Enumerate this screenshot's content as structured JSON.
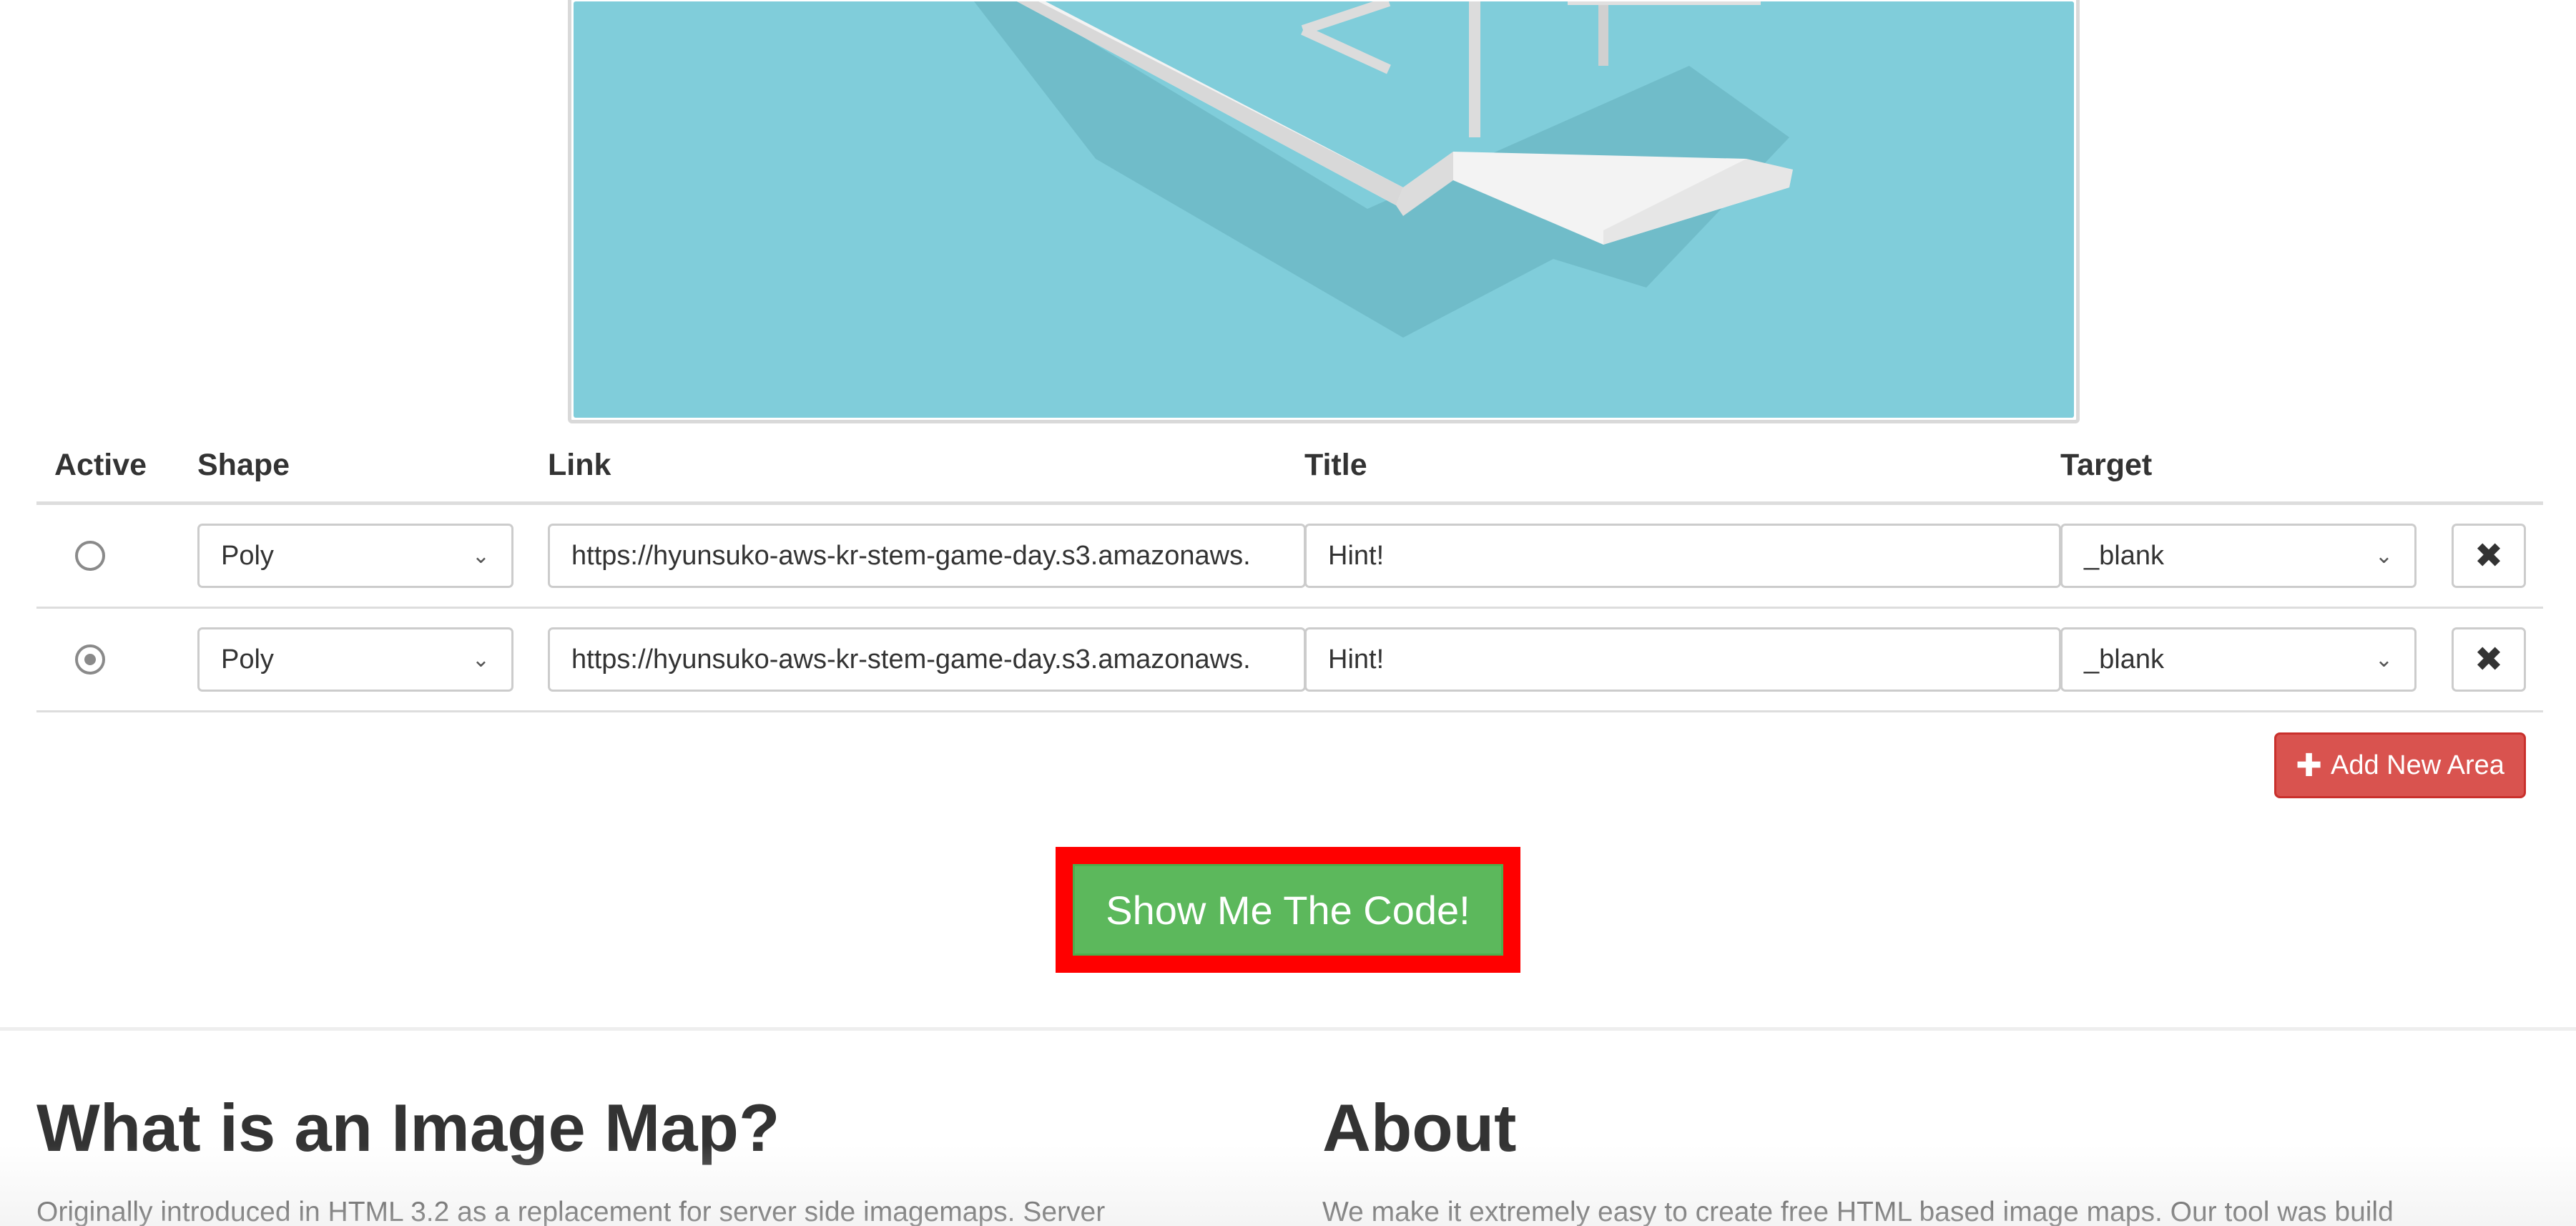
{
  "table": {
    "headers": {
      "active": "Active",
      "shape": "Shape",
      "link": "Link",
      "title": "Title",
      "target": "Target"
    },
    "rows": [
      {
        "active": false,
        "shape": "Poly",
        "link": "https://hyunsuko-aws-kr-stem-game-day.s3.amazonaws.",
        "title": "Hint!",
        "target": "_blank",
        "delete_icon": "close-icon"
      },
      {
        "active": true,
        "shape": "Poly",
        "link": "https://hyunsuko-aws-kr-stem-game-day.s3.amazonaws.",
        "title": "Hint!",
        "target": "_blank",
        "delete_icon": "close-icon"
      }
    ]
  },
  "buttons": {
    "add_new_area": "Add New Area",
    "show_code": "Show Me The Code!"
  },
  "sections": {
    "image_map": {
      "title": "What is an Image Map?",
      "text": "Originally introduced in HTML 3.2 as a replacement for server side imagemaps. Server"
    },
    "about": {
      "title": "About",
      "text": "We make it extremely easy to create free HTML based image maps. Our tool was build"
    }
  },
  "colors": {
    "preview_background": "#80cdda",
    "add_button": "#d9534f",
    "show_code_button": "#5cb85c",
    "highlight_frame": "#ff0000"
  },
  "icons": {
    "delete": "close-icon",
    "add": "plus-icon",
    "select": "chevron-down-icon"
  }
}
